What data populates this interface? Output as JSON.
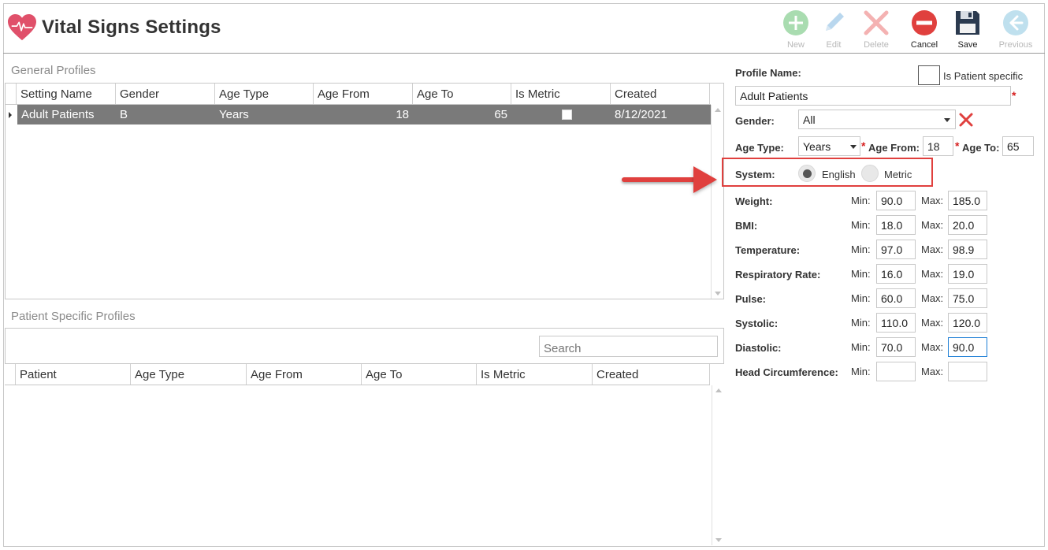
{
  "app": {
    "title": "Vital Signs Settings"
  },
  "toolbar": {
    "new_label": "New",
    "edit_label": "Edit",
    "delete_label": "Delete",
    "cancel_label": "Cancel",
    "save_label": "Save",
    "previous_label": "Previous"
  },
  "general_profiles": {
    "title": "General Profiles",
    "columns": [
      "Setting Name",
      "Gender",
      "Age Type",
      "Age From",
      "Age To",
      "Is Metric",
      "Created"
    ],
    "rows": [
      {
        "setting_name": "Adult Patients",
        "gender": "B",
        "age_type": "Years",
        "age_from": "18",
        "age_to": "65",
        "is_metric": false,
        "created": "8/12/2021"
      }
    ]
  },
  "patient_profiles": {
    "title": "Patient Specific Profiles",
    "search_placeholder": "Search",
    "columns": [
      "Patient",
      "Age Type",
      "Age From",
      "Age To",
      "Is Metric",
      "Created"
    ]
  },
  "form": {
    "profile_name_label": "Profile Name:",
    "is_patient_specific_label": "Is Patient specific",
    "profile_name_value": "Adult Patients",
    "gender_label": "Gender:",
    "gender_value": "All",
    "age_type_label": "Age Type:",
    "age_type_value": "Years",
    "age_from_label": "Age From:",
    "age_from_value": "18",
    "age_to_label": "Age To:",
    "age_to_value": "65",
    "system_label": "System:",
    "system_english": "English",
    "system_metric": "Metric",
    "system_selected": "English",
    "min_label": "Min:",
    "max_label": "Max:",
    "vitals": [
      {
        "label": "Weight:",
        "min": "90.0",
        "max": "185.0"
      },
      {
        "label": "BMI:",
        "min": "18.0",
        "max": "20.0"
      },
      {
        "label": "Temperature:",
        "min": "97.0",
        "max": "98.9"
      },
      {
        "label": "Respiratory Rate:",
        "min": "16.0",
        "max": "19.0"
      },
      {
        "label": "Pulse:",
        "min": "60.0",
        "max": "75.0"
      },
      {
        "label": "Systolic:",
        "min": "110.0",
        "max": "120.0"
      },
      {
        "label": "Diastolic:",
        "min": "70.0",
        "max": "90.0"
      },
      {
        "label": "Head Circumference:",
        "min": "",
        "max": ""
      }
    ]
  },
  "colors": {
    "accent_red": "#e0403e",
    "selected_row": "#7a7a7a",
    "focus_blue": "#1e7fd6",
    "new_icon": "#a9dcb0",
    "edit_icon": "#b9d7ee",
    "delete_icon": "#f4b2b2",
    "cancel_icon": "#e0403e",
    "save_icon": "#2b3a4f",
    "previous_icon": "#bfe0ee"
  },
  "icons": [
    "heart-pulse-icon",
    "plus-icon",
    "pencil-icon",
    "x-icon",
    "minus-circle-icon",
    "floppy-disk-icon",
    "arrow-left-icon",
    "clear-x-icon",
    "dropdown-caret-icon"
  ]
}
